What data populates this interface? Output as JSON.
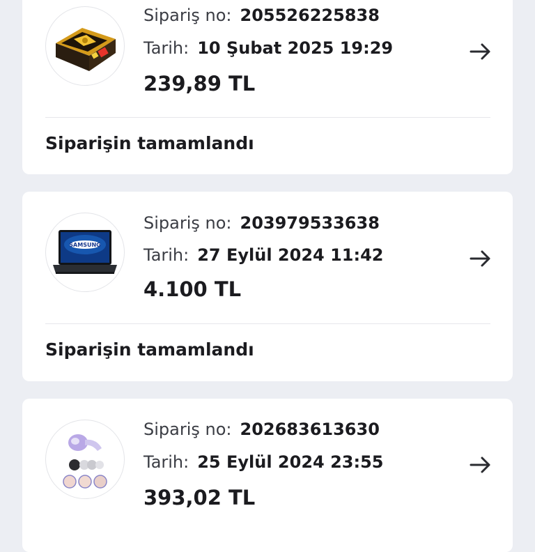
{
  "orders": [
    {
      "order_no_label": "Sipariş no:",
      "order_no": "205526225838",
      "date_label": "Tarih:",
      "date": "10 Şubat 2025 19:29",
      "price": "239,89 TL",
      "status": "Siparişin tamamlandı",
      "product_icon": "gift-box-product-image"
    },
    {
      "order_no_label": "Sipariş no:",
      "order_no": "203979533638",
      "date_label": "Tarih:",
      "date": "27 Eylül 2024 11:42",
      "price": "4.100 TL",
      "status": "Siparişin tamamlandı",
      "product_icon": "samsung-laptop-product-image",
      "product_brand_text": "SAMSUNG"
    },
    {
      "order_no_label": "Sipariş no:",
      "order_no": "202683613630",
      "date_label": "Tarih:",
      "date": "25 Eylül 2024 23:55",
      "price": "393,02 TL",
      "product_icon": "massager-product-image"
    }
  ],
  "colors": {
    "background": "#eceef3",
    "card": "#ffffff",
    "text": "#1b1b1f",
    "divider": "#e6e7eb"
  }
}
